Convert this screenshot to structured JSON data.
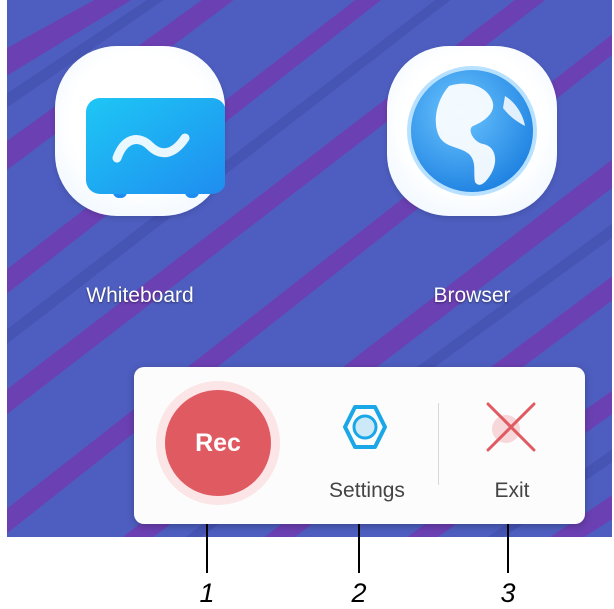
{
  "desktop": {
    "background_color": "#4e5ec0",
    "stripe_color": "#6d3fb3",
    "apps": [
      {
        "label": "Whiteboard",
        "icon": "whiteboard-icon"
      },
      {
        "label": "Browser",
        "icon": "globe-icon"
      }
    ]
  },
  "toolbar": {
    "rec_label": "Rec",
    "rec_color": "#e05a62",
    "settings_label": "Settings",
    "settings_icon": "hexagon-settings-icon",
    "exit_label": "Exit",
    "exit_icon": "close-icon"
  },
  "callouts": [
    "1",
    "2",
    "3"
  ]
}
